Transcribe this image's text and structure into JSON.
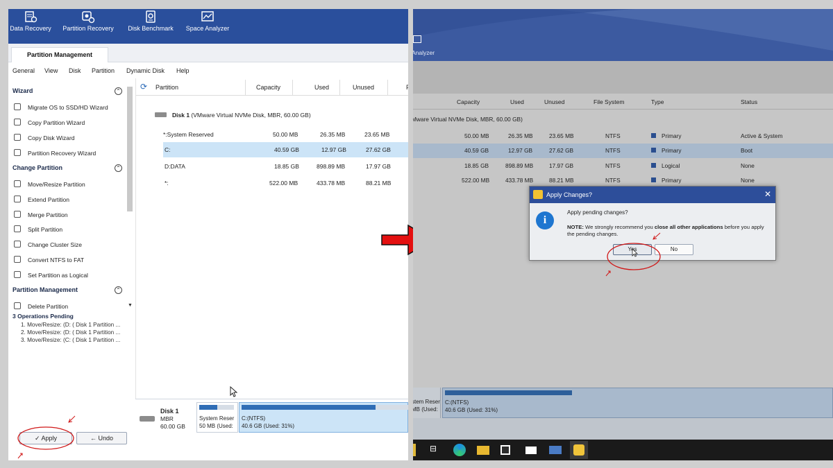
{
  "left": {
    "toolbar": [
      {
        "label": "Data Recovery",
        "icon": "data-recovery-icon"
      },
      {
        "label": "Partition Recovery",
        "icon": "partition-recovery-icon"
      },
      {
        "label": "Disk Benchmark",
        "icon": "disk-benchmark-icon"
      },
      {
        "label": "Space Analyzer",
        "icon": "space-analyzer-icon"
      }
    ],
    "tab": "Partition Management",
    "menu": [
      "General",
      "View",
      "Disk",
      "Partition",
      "Dynamic Disk",
      "Help"
    ],
    "sidebar": {
      "wizard_title": "Wizard",
      "wizard_items": [
        "Migrate OS to SSD/HD Wizard",
        "Copy Partition Wizard",
        "Copy Disk Wizard",
        "Partition Recovery Wizard"
      ],
      "change_title": "Change Partition",
      "change_items": [
        "Move/Resize Partition",
        "Extend Partition",
        "Merge Partition",
        "Split Partition",
        "Change Cluster Size",
        "Convert NTFS to FAT",
        "Set Partition as Logical"
      ],
      "pm_title": "Partition Management",
      "pm_items": [
        "Delete Partition"
      ],
      "pending_title": "3 Operations Pending",
      "pending_items": [
        "1. Move/Resize: (D: ( Disk 1 Partition ...",
        "2. Move/Resize: (D: ( Disk 1 Partition ...",
        "3. Move/Resize: (C: ( Disk 1 Partition ..."
      ]
    },
    "table": {
      "columns": [
        "Partition",
        "Capacity",
        "Used",
        "Unused",
        "F"
      ],
      "disk_label": "Disk 1",
      "disk_desc": "(VMware Virtual NVMe Disk, MBR, 60.00 GB)",
      "rows": [
        {
          "name": "*:System Reserved",
          "capacity": "50.00 MB",
          "used": "26.35 MB",
          "unused": "23.65 MB"
        },
        {
          "name": "C:",
          "capacity": "40.59 GB",
          "used": "12.97 GB",
          "unused": "27.62 GB"
        },
        {
          "name": "D:DATA",
          "capacity": "18.85 GB",
          "used": "898.89 MB",
          "unused": "17.97 GB"
        },
        {
          "name": "*:",
          "capacity": "522.00 MB",
          "used": "433.78 MB",
          "unused": "88.21 MB"
        }
      ]
    },
    "diskmap": {
      "disk": "Disk 1",
      "type": "MBR",
      "size": "60.00 GB",
      "p1_name": "System Reser",
      "p1_info": "50 MB (Used:",
      "p1_used_pct": 52,
      "p2_name": "C:(NTFS)",
      "p2_info": "40.6 GB (Used: 31%)",
      "p2_used_pct": 31
    },
    "apply_label": "Apply",
    "undo_label": "Undo"
  },
  "right": {
    "toolbar_partial": "Analyzer",
    "columns": [
      "Capacity",
      "Used",
      "Unused",
      "File System",
      "Type",
      "Status"
    ],
    "disk_desc": "Mware Virtual NVMe Disk, MBR, 60.00 GB)",
    "rows": [
      {
        "capacity": "50.00 MB",
        "used": "26.35 MB",
        "unused": "23.65 MB",
        "fs": "NTFS",
        "type": "Primary",
        "status": "Active & System"
      },
      {
        "capacity": "40.59 GB",
        "used": "12.97 GB",
        "unused": "27.62 GB",
        "fs": "NTFS",
        "type": "Primary",
        "status": "Boot"
      },
      {
        "capacity": "18.85 GB",
        "used": "898.89 MB",
        "unused": "17.97 GB",
        "fs": "NTFS",
        "type": "Logical",
        "status": "None"
      },
      {
        "capacity": "522.00 MB",
        "used": "433.78 MB",
        "unused": "88.21 MB",
        "fs": "NTFS",
        "type": "Primary",
        "status": "None"
      }
    ],
    "diskmap": {
      "p1_name": "stem Reser",
      "p1_info": "MB (Used:",
      "p2_name": "C:(NTFS)",
      "p2_info": "40.6 GB (Used: 31%)"
    },
    "dialog": {
      "title": "Apply Changes?",
      "question": "Apply pending changes?",
      "note_label": "NOTE:",
      "note_a": " We strongly recommend you ",
      "note_bold": "close all other applications",
      "note_b": " before you apply the pending changes.",
      "yes": "Yes",
      "no": "No"
    }
  },
  "colors": {
    "accent": "#2a4f9c",
    "selected_row": "#cce4f7",
    "annotation": "#d01818"
  }
}
